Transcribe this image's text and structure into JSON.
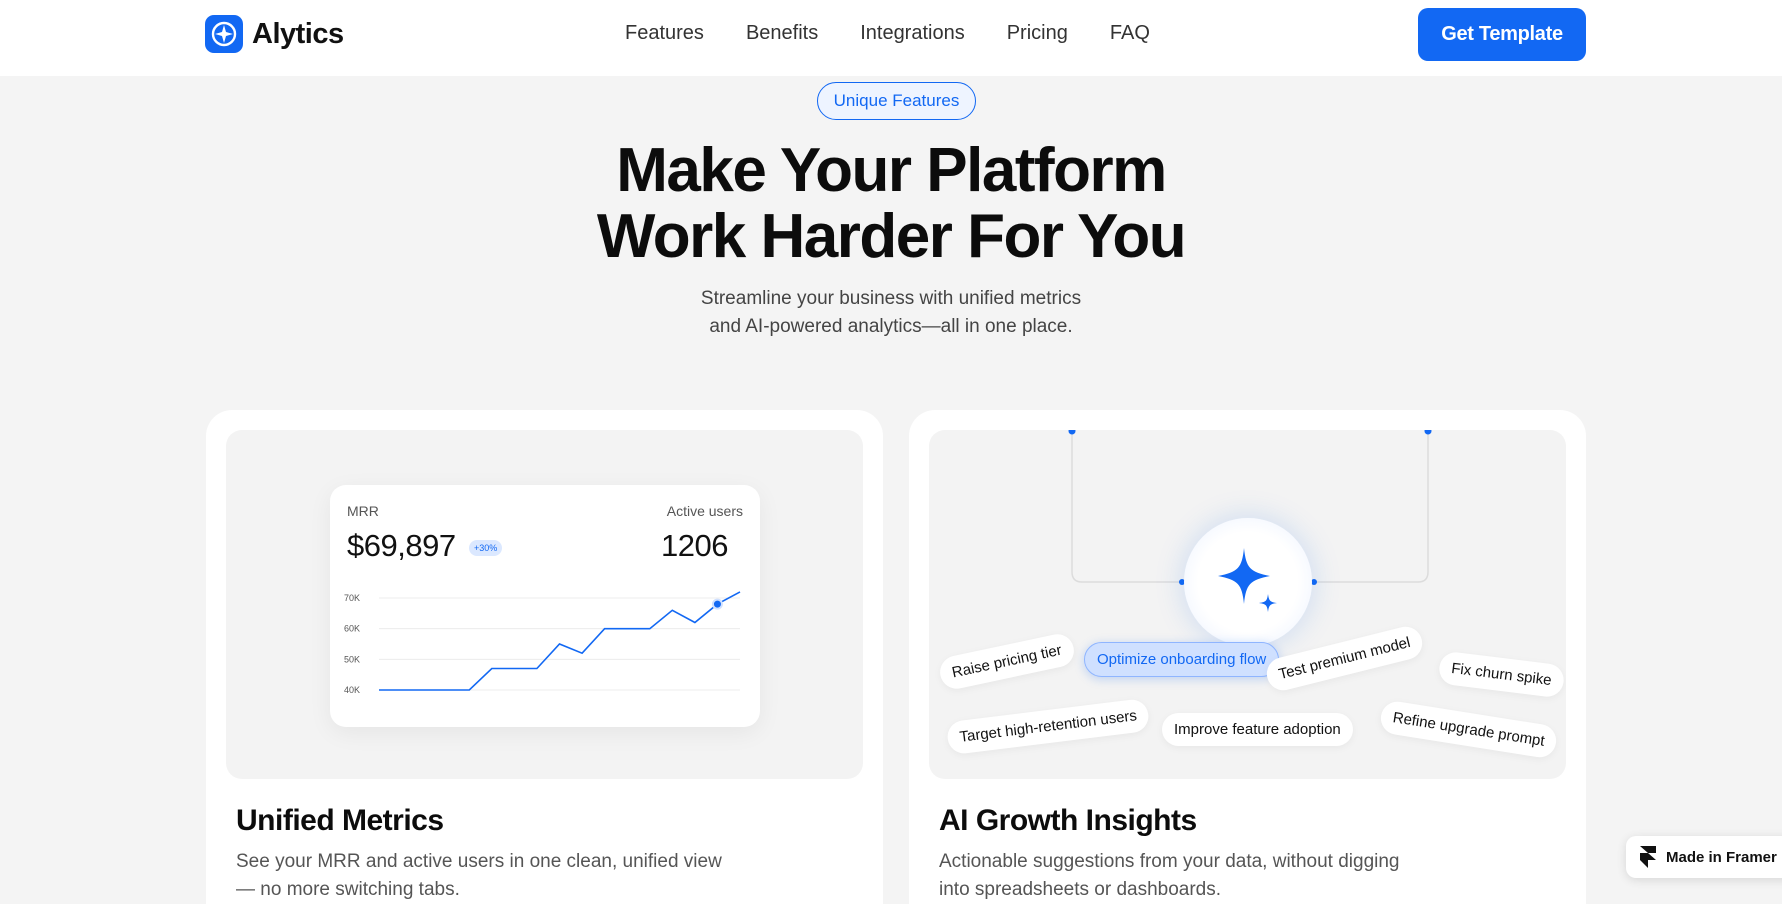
{
  "nav": {
    "brand": "Alytics",
    "links": [
      "Features",
      "Benefits",
      "Integrations",
      "Pricing",
      "FAQ"
    ],
    "cta": "Get Template"
  },
  "hero": {
    "badge": "Unique Features",
    "title_line1": "Make Your Platform",
    "title_line2": "Work Harder For You",
    "subtitle_line1": "Streamline your business with unified metrics",
    "subtitle_line2": "and AI-powered analytics—all in one place."
  },
  "cards": {
    "metrics": {
      "title": "Unified Metrics",
      "desc_line1": "See your MRR and active users in one clean, unified view",
      "desc_line2": "— no more switching tabs.",
      "mrr_label": "MRR",
      "mrr_value": "$69,897",
      "mrr_delta": "+30%",
      "users_label": "Active users",
      "users_value": "1206"
    },
    "ai": {
      "title": "AI Growth Insights",
      "desc_line1": "Actionable suggestions from your data, without digging",
      "desc_line2": "into spreadsheets or dashboards.",
      "chips": [
        "Raise pricing tier",
        "Optimize onboarding flow",
        "Test premium model",
        "Fix churn spike",
        "Target high-retention users",
        "Improve feature adoption",
        "Refine upgrade prompt"
      ]
    }
  },
  "chart_data": {
    "type": "line",
    "title": "",
    "xlabel": "",
    "ylabel": "",
    "y_ticks": [
      "70K",
      "60K",
      "50K",
      "40K"
    ],
    "ylim": [
      40000,
      70000
    ],
    "grid": true,
    "color": "#1268f3",
    "series": [
      {
        "values": [
          40000,
          40000,
          40000,
          40000,
          40000,
          47000,
          47000,
          47000,
          55000,
          52000,
          60000,
          60000,
          60000,
          66000,
          62000,
          68000,
          72000
        ]
      }
    ]
  },
  "framer_badge": "Made in Framer",
  "colors": {
    "accent": "#1268f3",
    "background": "#f4f4f4"
  }
}
